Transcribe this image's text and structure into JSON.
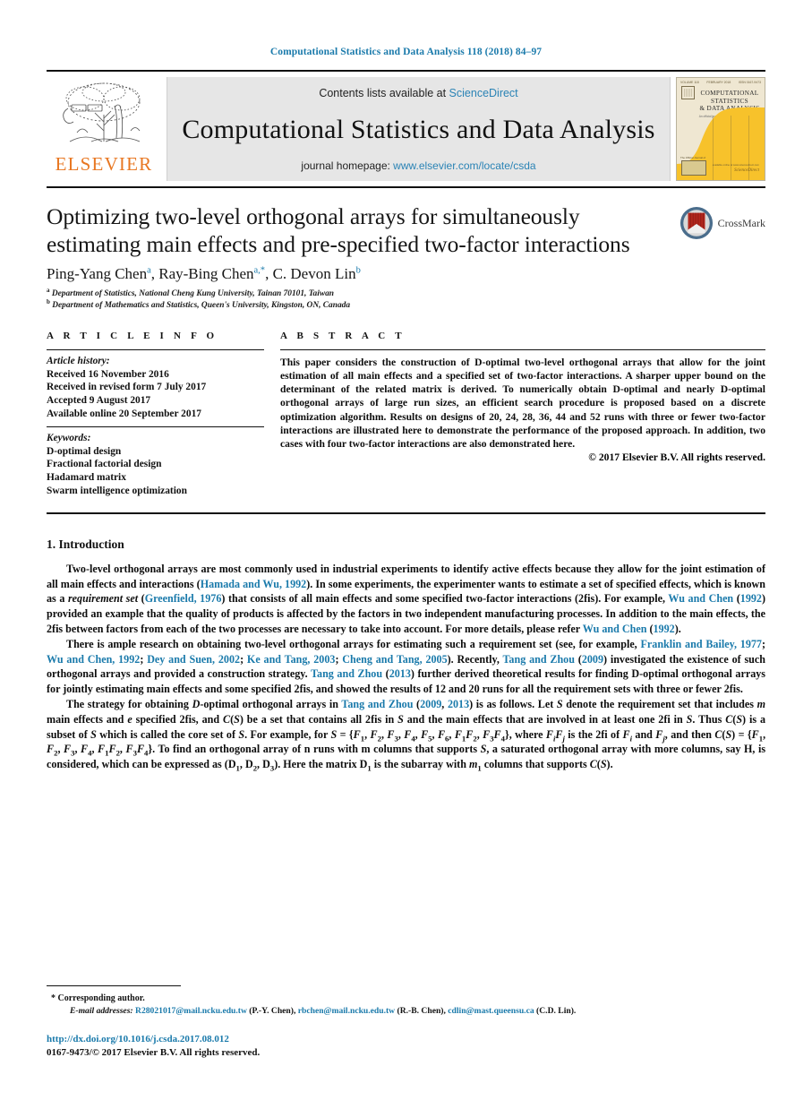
{
  "running_head": "Computational Statistics and Data Analysis 118 (2018) 84–97",
  "masthead": {
    "publisher_name": "ELSEVIER",
    "contents_prefix": "Contents lists available at ",
    "contents_link": "ScienceDirect",
    "journal_title": "Computational Statistics and Data Analysis",
    "homepage_prefix": "journal homepage: ",
    "homepage_url": "www.elsevier.com/locate/csda",
    "cover": {
      "volume_line": "VOLUME 118",
      "date_line": "FEBRUARY 2018",
      "issn_line": "ISSN 0167-9473",
      "title_line1": "COMPUTATIONAL",
      "title_line2": "STATISTICS",
      "title_line3": "& DATA ANALYSIS",
      "subtitle": "An official journal of the International Association for Statistical Computing",
      "footer_label": "The Official Journal of",
      "sd_top": "available online at www.sciencedirect.com",
      "sd_word": "ScienceDirect",
      "curve_color": "#f7c22b"
    }
  },
  "article": {
    "title": "Optimizing two-level orthogonal arrays for simultaneously estimating main effects and pre-specified two-factor interactions",
    "authors": [
      {
        "name": "Ping-Yang Chen",
        "marks": "a"
      },
      {
        "name": "Ray-Bing Chen",
        "marks": "a,*"
      },
      {
        "name": "C. Devon Lin",
        "marks": "b"
      }
    ],
    "affiliations": [
      {
        "mark": "a",
        "text": "Department of Statistics, National Cheng Kung University, Tainan 70101, Taiwan"
      },
      {
        "mark": "b",
        "text": "Department of Mathematics and Statistics, Queen's University, Kingston, ON, Canada"
      }
    ],
    "crossmark_label": "CrossMark"
  },
  "article_info": {
    "heading": "A R T I C L E   I N F O",
    "history_label": "Article history:",
    "history": [
      "Received 16 November 2016",
      "Received in revised form 7 July 2017",
      "Accepted 9 August 2017",
      "Available online 20 September 2017"
    ],
    "keywords_label": "Keywords:",
    "keywords": [
      "D-optimal design",
      "Fractional factorial design",
      "Hadamard matrix",
      "Swarm intelligence optimization"
    ]
  },
  "abstract": {
    "heading": "A B S T R A C T",
    "text": "This paper considers the construction of D-optimal two-level orthogonal arrays that allow for the joint estimation of all main effects and a specified set of two-factor interactions. A sharper upper bound on the determinant of the related matrix is derived. To numerically obtain D-optimal and nearly D-optimal orthogonal arrays of large run sizes, an efficient search procedure is proposed based on a discrete optimization algorithm. Results on designs of 20, 24, 28, 36, 44 and 52 runs with three or fewer two-factor interactions are illustrated here to demonstrate the performance of the proposed approach. In addition, two cases with four two-factor interactions are also demonstrated here.",
    "copyright": "© 2017 Elsevier B.V. All rights reserved."
  },
  "section": {
    "number_title": "1. Introduction",
    "paragraphs": [
      {
        "id": "p1",
        "parts": [
          {
            "t": "Two-level orthogonal arrays are most commonly used in industrial experiments to identify active effects because they allow for the joint estimation of all main effects and interactions ("
          },
          {
            "t": "Hamada and Wu, 1992",
            "k": "ref"
          },
          {
            "t": "). In some experiments, the experimenter wants to estimate a set of specified effects, which is known as a "
          },
          {
            "t": "requirement set",
            "k": "it"
          },
          {
            "t": " ("
          },
          {
            "t": "Greenfield, 1976",
            "k": "ref"
          },
          {
            "t": ") that consists of all main effects and some specified two-factor interactions (2fis). For example, "
          },
          {
            "t": "Wu and Chen",
            "k": "ref"
          },
          {
            "t": " ("
          },
          {
            "t": "1992",
            "k": "ref"
          },
          {
            "t": ") provided an example that the quality of products is affected by the factors in two independent manufacturing processes. In addition to the main effects, the 2fis between factors from each of the two processes are necessary to take into account. For more details, please refer "
          },
          {
            "t": "Wu and Chen",
            "k": "ref"
          },
          {
            "t": " ("
          },
          {
            "t": "1992",
            "k": "ref"
          },
          {
            "t": ")."
          }
        ]
      },
      {
        "id": "p2",
        "parts": [
          {
            "t": "There is ample research on obtaining two-level orthogonal arrays for estimating such a requirement set (see, for example, "
          },
          {
            "t": "Franklin and Bailey, 1977",
            "k": "ref"
          },
          {
            "t": "; "
          },
          {
            "t": "Wu and Chen, 1992",
            "k": "ref"
          },
          {
            "t": "; "
          },
          {
            "t": "Dey and Suen, 2002",
            "k": "ref"
          },
          {
            "t": "; "
          },
          {
            "t": "Ke and Tang, 2003",
            "k": "ref"
          },
          {
            "t": "; "
          },
          {
            "t": "Cheng and Tang, 2005",
            "k": "ref"
          },
          {
            "t": "). Recently, "
          },
          {
            "t": "Tang and Zhou",
            "k": "ref"
          },
          {
            "t": " ("
          },
          {
            "t": "2009",
            "k": "ref"
          },
          {
            "t": ") investigated the existence of such orthogonal arrays and provided a construction strategy. "
          },
          {
            "t": "Tang and Zhou",
            "k": "ref"
          },
          {
            "t": " ("
          },
          {
            "t": "2013",
            "k": "ref"
          },
          {
            "t": ") further derived theoretical results for finding D-optimal orthogonal arrays for jointly estimating main effects and some specified 2fis, and showed the results of 12 and 20 runs for all the requirement sets with three or fewer 2fis."
          }
        ]
      }
    ],
    "paragraph3_html": "The strategy for obtaining <i>D</i>-optimal orthogonal arrays in <span class=\"ref\">Tang and Zhou</span> (<span class=\"ref\">2009</span>, <span class=\"ref\">2013</span>) is as follows. Let <i>S</i> denote the requirement set that includes <i>m</i> main effects and <i>e</i> specified 2fis, and <i>C</i>(<i>S</i>) be a set that contains all 2fis in <i>S</i> and the main effects that are involved in at least one 2fi in <i>S</i>. Thus <i>C</i>(<i>S</i>) is a subset of <i>S</i> which is called the core set of <i>S</i>. For example, for <i>S</i> = {<i>F</i><span class=\"sub\">1</span>, <i>F</i><span class=\"sub\">2</span>, <i>F</i><span class=\"sub\">3</span>, <i>F</i><span class=\"sub\">4</span>, <i>F</i><span class=\"sub\">5</span>, <i>F</i><span class=\"sub\">6</span>, <i>F</i><span class=\"sub\">1</span><i>F</i><span class=\"sub\">2</span>, <i>F</i><span class=\"sub\">3</span><i>F</i><span class=\"sub\">4</span>}, where <i>F<span class=\"sub\">i</span>F<span class=\"sub\">j</span></i> is the 2fi of <i>F<span class=\"sub\">i</span></i> and <i>F<span class=\"sub\">j</span></i>, and then <i>C</i>(<i>S</i>) = {<i>F</i><span class=\"sub\">1</span>, <i>F</i><span class=\"sub\">2</span>, <i>F</i><span class=\"sub\">3</span>, <i>F</i><span class=\"sub\">4</span>, <i>F</i><span class=\"sub\">1</span><i>F</i><span class=\"sub\">2</span>, <i>F</i><span class=\"sub\">3</span><i>F</i><span class=\"sub\">4</span>}. To find an orthogonal array of n runs with m columns that supports <i>S</i>, a saturated orthogonal array with more columns, say <b>H</b>, is considered, which can be expressed as (<b>D</b><span class=\"sub\">1</span>, <b>D</b><span class=\"sub\">2</span>, <b>D</b><span class=\"sub\">3</span>). Here the matrix <b>D</b><span class=\"sub\">1</span> is the subarray with <i>m</i><span class=\"sub\">1</span> columns that supports <i>C</i>(<i>S</i>)."
  },
  "footer": {
    "corresponding": "* Corresponding author.",
    "emails_label": "E-mail addresses:",
    "emails": [
      {
        "address": "R28021017@mail.ncku.edu.tw",
        "person": "(P.-Y. Chen)"
      },
      {
        "address": "rbchen@mail.ncku.edu.tw",
        "person": "(R.-B. Chen)"
      },
      {
        "address": "cdlin@mast.queensu.ca",
        "person": "(C.D. Lin)"
      }
    ],
    "doi": "http://dx.doi.org/10.1016/j.csda.2017.08.012",
    "issn_line": "0167-9473/© 2017 Elsevier B.V. All rights reserved."
  },
  "colors": {
    "link": "#1a7aab",
    "sciencedirect": "#2a83b5",
    "elsevier_orange": "#e87722",
    "band_gray": "#e6e6e6",
    "cover_yellow": "#f7c22b",
    "rule_black": "#111111"
  }
}
